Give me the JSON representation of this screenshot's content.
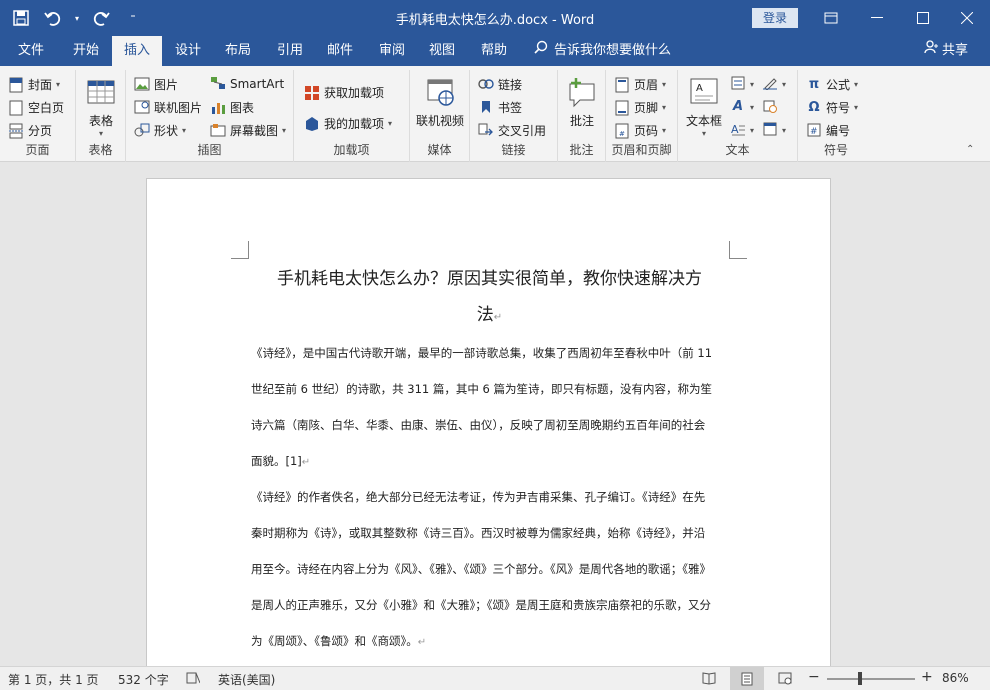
{
  "titlebar": {
    "title": "手机耗电太快怎么办.docx  -  Word",
    "login": "登录"
  },
  "menu": {
    "tabs": [
      "文件",
      "开始",
      "插入",
      "设计",
      "布局",
      "引用",
      "邮件",
      "审阅",
      "视图",
      "帮助"
    ],
    "active_tab": "插入",
    "tellme": "告诉我你想要做什么",
    "share": "共享"
  },
  "ribbon": {
    "pages": {
      "cover": "封面",
      "blank": "空白页",
      "break": "分页",
      "label": "页面"
    },
    "tables": {
      "table": "表格",
      "label": "表格"
    },
    "illustrations": {
      "picture": "图片",
      "online_picture": "联机图片",
      "shapes": "形状",
      "smartart": "SmartArt",
      "chart": "图表",
      "screenshot": "屏幕截图",
      "label": "插图"
    },
    "addins": {
      "get": "获取加载项",
      "my": "我的加载项",
      "label": "加载项"
    },
    "media": {
      "online_video": "联机视频",
      "label": "媒体"
    },
    "links": {
      "link": "链接",
      "bookmark": "书签",
      "crossref": "交叉引用",
      "label": "链接"
    },
    "comments": {
      "comment": "批注",
      "label": "批注"
    },
    "header_footer": {
      "header": "页眉",
      "footer": "页脚",
      "page_number": "页码",
      "label": "页眉和页脚"
    },
    "text": {
      "textbox": "文本框",
      "label": "文本"
    },
    "symbols": {
      "equation": "公式",
      "symbol": "符号",
      "number": "编号",
      "label": "符号"
    }
  },
  "document": {
    "title_line1": "手机耗电太快怎么办？原因其实很简单，教你快速解决方",
    "title_line2": "法",
    "para1": [
      "《诗经》，是中国古代诗歌开端，最早的一部诗歌总集，收集了西周初年至春秋中叶（前 11",
      "世纪至前 6 世纪）的诗歌，共 311 篇，其中 6 篇为笙诗，即只有标题，没有内容，称为笙",
      "诗六篇（南陔、白华、华黍、由康、崇伍、由仪），反映了周初至周晚期约五百年间的社会",
      "面貌。[1]"
    ],
    "para2": [
      "《诗经》的作者佚名，绝大部分已经无法考证，传为尹吉甫采集、孔子编订。《诗经》在先",
      "秦时期称为《诗》，或取其整数称《诗三百》。西汉时被尊为儒家经典，始称《诗经》，并沿",
      "用至今。诗经在内容上分为《风》、《雅》、《颂》三个部分。《风》是周代各地的歌谣；《雅》",
      "是周人的正声雅乐，又分《小雅》和《大雅》；《颂》是周王庭和贵族宗庙祭祀的乐歌，又分",
      "为《周颂》、《鲁颂》和《商颂》。"
    ]
  },
  "status": {
    "page": "第 1 页，共 1 页",
    "words": "532 个字",
    "language": "英语(美国)",
    "zoom": "86%"
  }
}
